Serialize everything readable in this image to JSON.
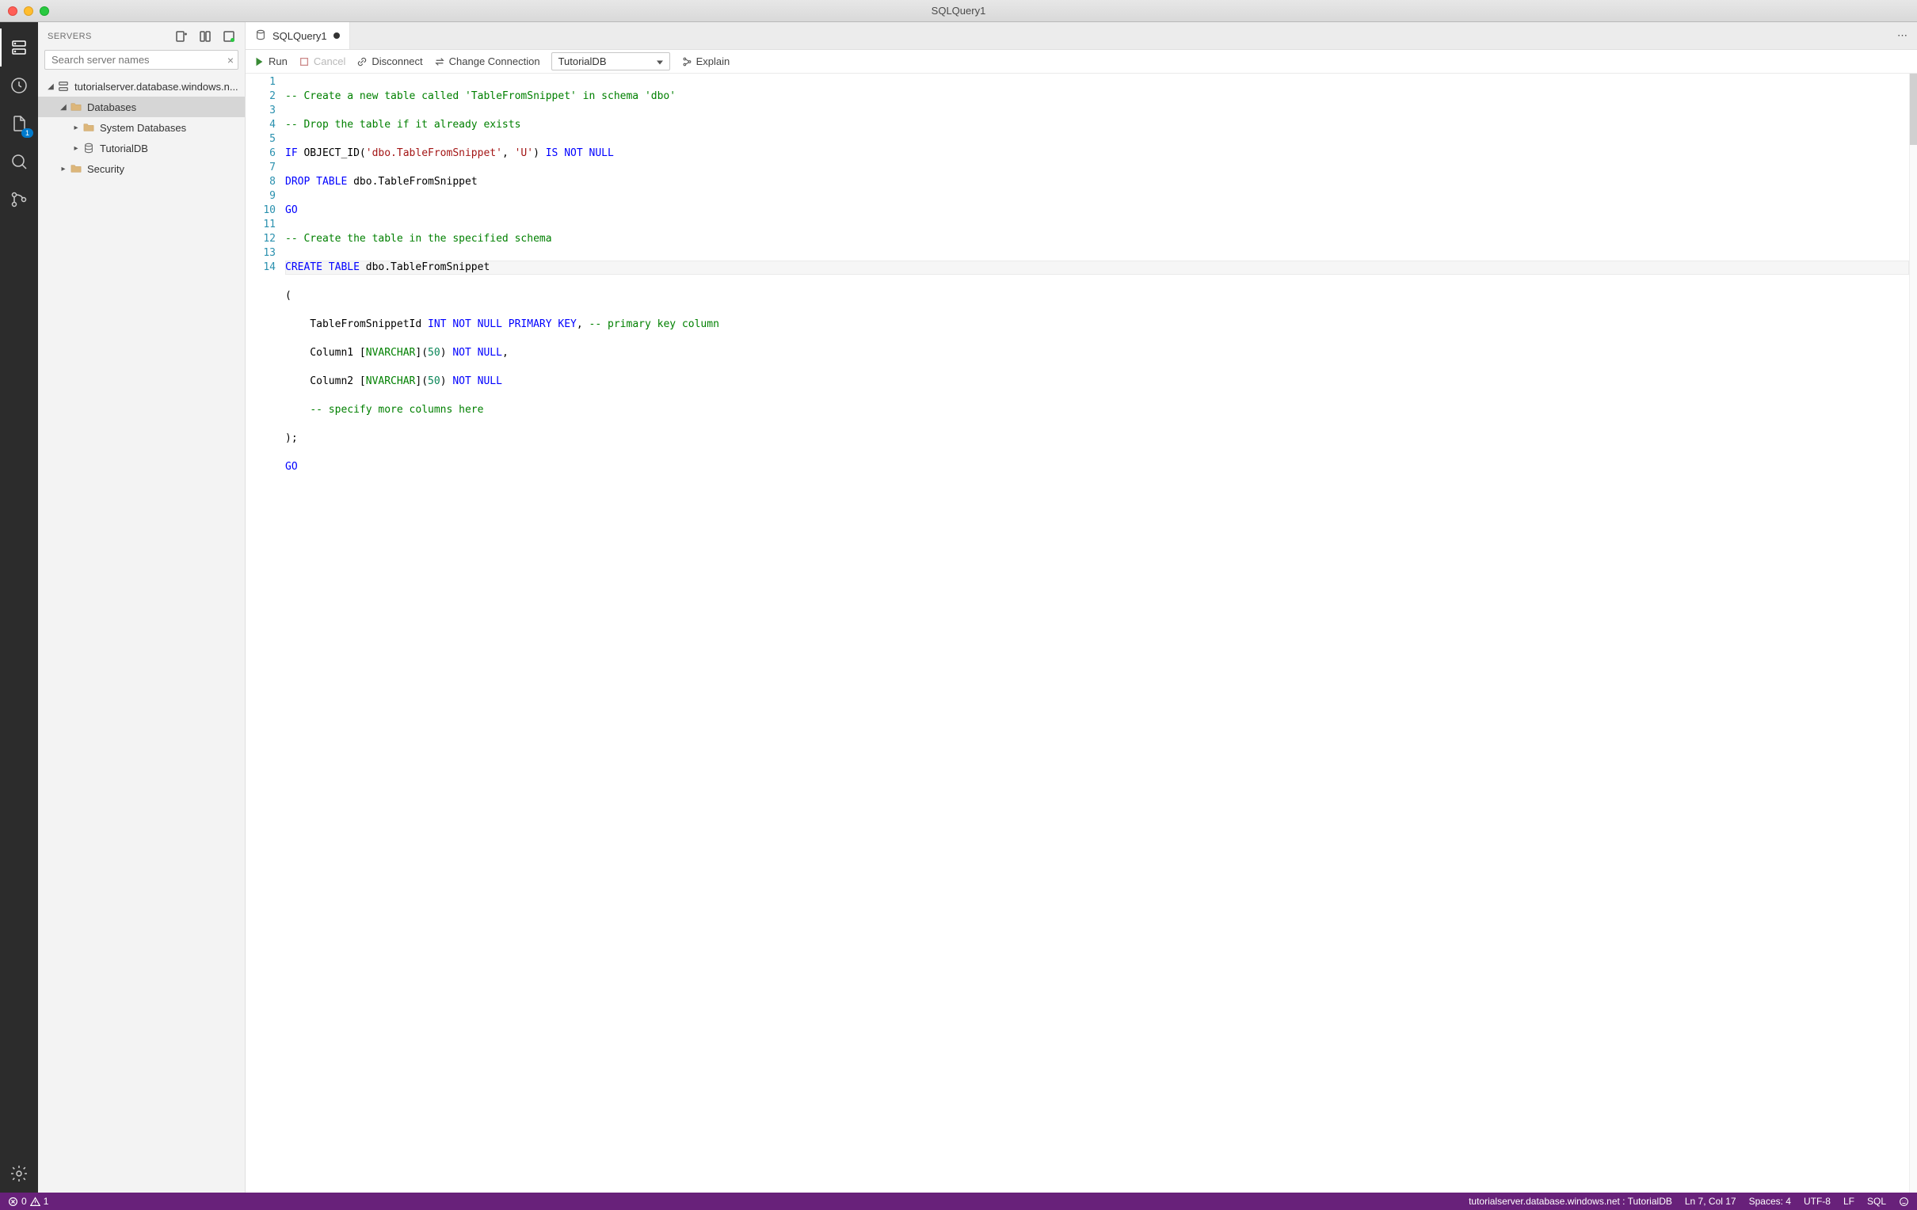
{
  "window": {
    "title": "SQLQuery1"
  },
  "sidebar": {
    "title": "SERVERS",
    "search_placeholder": "Search server names",
    "tree": {
      "root": "tutorialserver.database.windows.n...",
      "databases_label": "Databases",
      "system_databases_label": "System Databases",
      "tutorialdb_label": "TutorialDB",
      "security_label": "Security"
    }
  },
  "activitybar": {
    "task_badge": "1"
  },
  "tabs": {
    "active_tab": "SQLQuery1"
  },
  "toolbar": {
    "run": "Run",
    "cancel": "Cancel",
    "disconnect": "Disconnect",
    "change_connection": "Change Connection",
    "database": "TutorialDB",
    "explain": "Explain"
  },
  "editor": {
    "line_count": 14,
    "lines": [
      {
        "n": 1
      },
      {
        "n": 2
      },
      {
        "n": 3
      },
      {
        "n": 4
      },
      {
        "n": 5
      },
      {
        "n": 6
      },
      {
        "n": 7
      },
      {
        "n": 8
      },
      {
        "n": 9
      },
      {
        "n": 10
      },
      {
        "n": 11
      },
      {
        "n": 12
      },
      {
        "n": 13
      },
      {
        "n": 14
      }
    ],
    "code": {
      "l1_comment": "-- Create a new table called 'TableFromSnippet' in schema 'dbo'",
      "l2_comment": "-- Drop the table if it already exists",
      "l3_if": "IF",
      "l3_objid": " OBJECT_ID(",
      "l3_str1": "'dbo.TableFromSnippet'",
      "l3_comma": ", ",
      "l3_str2": "'U'",
      "l3_close": ") ",
      "l3_isnotnull": "IS NOT NULL",
      "l4_drop": "DROP TABLE",
      "l4_ident": " dbo.TableFromSnippet",
      "l5_go": "GO",
      "l6_comment": "-- Create the table in the specified schema",
      "l7_create": "CREATE TABLE",
      "l7_ident": " dbo.TableFromSnippet",
      "l8_paren": "(",
      "l9_indent": "    TableFromSnippetId ",
      "l9_int": "INT",
      "l9_sp1": " ",
      "l9_notnull": "NOT NULL",
      "l9_sp2": " ",
      "l9_pk": "PRIMARY KEY",
      "l9_comma": ", ",
      "l9_comment": "-- primary key column",
      "l10_indent": "    Column1 [",
      "l10_type": "NVARCHAR",
      "l10_br": "](",
      "l10_num": "50",
      "l10_close": ") ",
      "l10_notnull": "NOT NULL",
      "l10_comma": ",",
      "l11_indent": "    Column2 [",
      "l11_type": "NVARCHAR",
      "l11_br": "](",
      "l11_num": "50",
      "l11_close": ") ",
      "l11_notnull": "NOT NULL",
      "l12_indent": "    ",
      "l12_comment": "-- specify more columns here",
      "l13_close": ");",
      "l14_go": "GO"
    }
  },
  "status": {
    "errors": "0",
    "warnings": "1",
    "connection": "tutorialserver.database.windows.net : TutorialDB",
    "cursor": "Ln 7, Col 17",
    "spaces": "Spaces: 4",
    "encoding": "UTF-8",
    "eol": "LF",
    "language": "SQL"
  }
}
